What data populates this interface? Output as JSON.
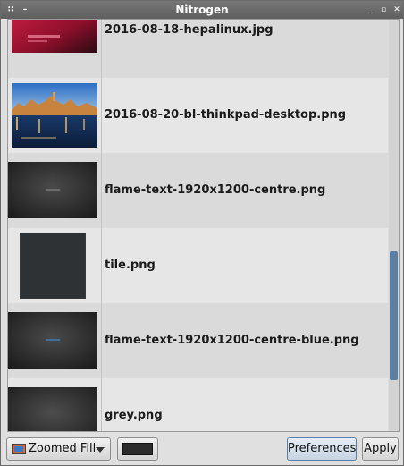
{
  "window": {
    "title": "Nitrogen",
    "controls": {
      "menu": "∷",
      "shade": "–",
      "minimize": "_",
      "maximize": "▫",
      "close": "✕"
    }
  },
  "files": [
    {
      "name": "2016-08-18-hepalinux.jpg",
      "thumb": "red-abstract"
    },
    {
      "name": "2016-08-20-bl-thinkpad-desktop.png",
      "thumb": "venice"
    },
    {
      "name": "flame-text-1920x1200-centre.png",
      "thumb": "dark-gray"
    },
    {
      "name": "tile.png",
      "thumb": "tile"
    },
    {
      "name": "flame-text-1920x1200-centre-blue.png",
      "thumb": "dark-gray"
    },
    {
      "name": "grey.png",
      "thumb": "dark-gray"
    }
  ],
  "scrollbar": {
    "position_fraction": 0.56,
    "thumb_color": "#5c7fa6"
  },
  "toolbar": {
    "mode_label": "Zoomed Fill",
    "bg_color": "#2c2c2c",
    "preferences_label": "Preferences",
    "apply_label": "Apply"
  }
}
